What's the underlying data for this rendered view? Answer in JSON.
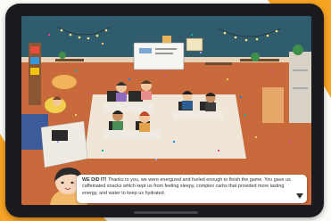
{
  "dialog": {
    "highlight": "WE DID IT!",
    "text": " Thanks to you, we were energized and fueled enough to finish the game. You gave us caffeinated snacks which kept us from feeling sleepy, complex carbs that provided more lasting energy, and water to keep us hydrated."
  },
  "icons": {
    "advance": "triangle-down-icon"
  },
  "colors": {
    "background_accent": "#f7a324",
    "floor": "#c86a3b",
    "rug": "#efe6d8",
    "wall": "#2f5d6e",
    "dialog_bg": "#ffffff"
  }
}
